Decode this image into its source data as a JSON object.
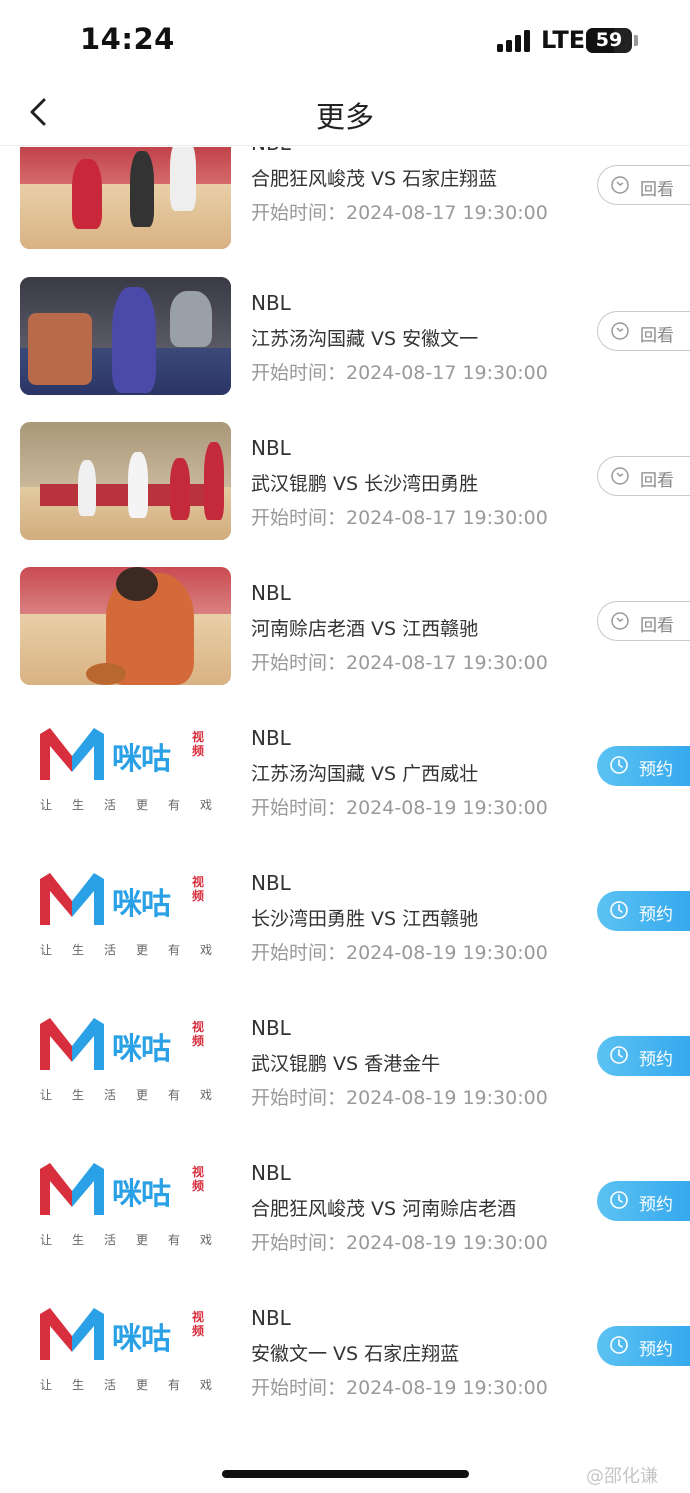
{
  "status": {
    "time": "14:24",
    "network": "LTE",
    "battery": "59"
  },
  "nav": {
    "title": "更多"
  },
  "items": [
    {
      "league": "NBL",
      "match": "合肥狂风峻茂 VS 石家庄翔蓝",
      "start": "开始时间：2024-08-17 19:30:00",
      "action": "回看"
    },
    {
      "league": "NBL",
      "match": "江苏汤沟国藏 VS 安徽文一",
      "start": "开始时间：2024-08-17 19:30:00",
      "action": "回看"
    },
    {
      "league": "NBL",
      "match": "武汉锟鹏 VS 长沙湾田勇胜",
      "start": "开始时间：2024-08-17 19:30:00",
      "action": "回看"
    },
    {
      "league": "NBL",
      "match": "河南赊店老酒 VS 江西赣驰",
      "start": "开始时间：2024-08-17 19:30:00",
      "action": "回看"
    },
    {
      "league": "NBL",
      "match": "江苏汤沟国藏 VS 广西威壮",
      "start": "开始时间：2024-08-19 19:30:00",
      "action": "预约"
    },
    {
      "league": "NBL",
      "match": "长沙湾田勇胜 VS 江西赣驰",
      "start": "开始时间：2024-08-19 19:30:00",
      "action": "预约"
    },
    {
      "league": "NBL",
      "match": "武汉锟鹏 VS 香港金牛",
      "start": "开始时间：2024-08-19 19:30:00",
      "action": "预约"
    },
    {
      "league": "NBL",
      "match": "合肥狂风峻茂 VS 河南赊店老酒",
      "start": "开始时间：2024-08-19 19:30:00",
      "action": "预约"
    },
    {
      "league": "NBL",
      "match": "安徽文一 VS 石家庄翔蓝",
      "start": "开始时间：2024-08-19 19:30:00",
      "action": "预约"
    }
  ],
  "logo": {
    "name": "咪咕",
    "sub": "视频",
    "slogan": "让生活更有戏"
  },
  "watermark": "@邵化谦",
  "colors": {
    "accent": "#3aa9ee",
    "brand_red": "#d82f3e",
    "brand_blue": "#2aa0e6"
  },
  "icons": {
    "back": "chevron-left-icon",
    "replay": "replay-icon",
    "reserve": "clock-icon"
  }
}
